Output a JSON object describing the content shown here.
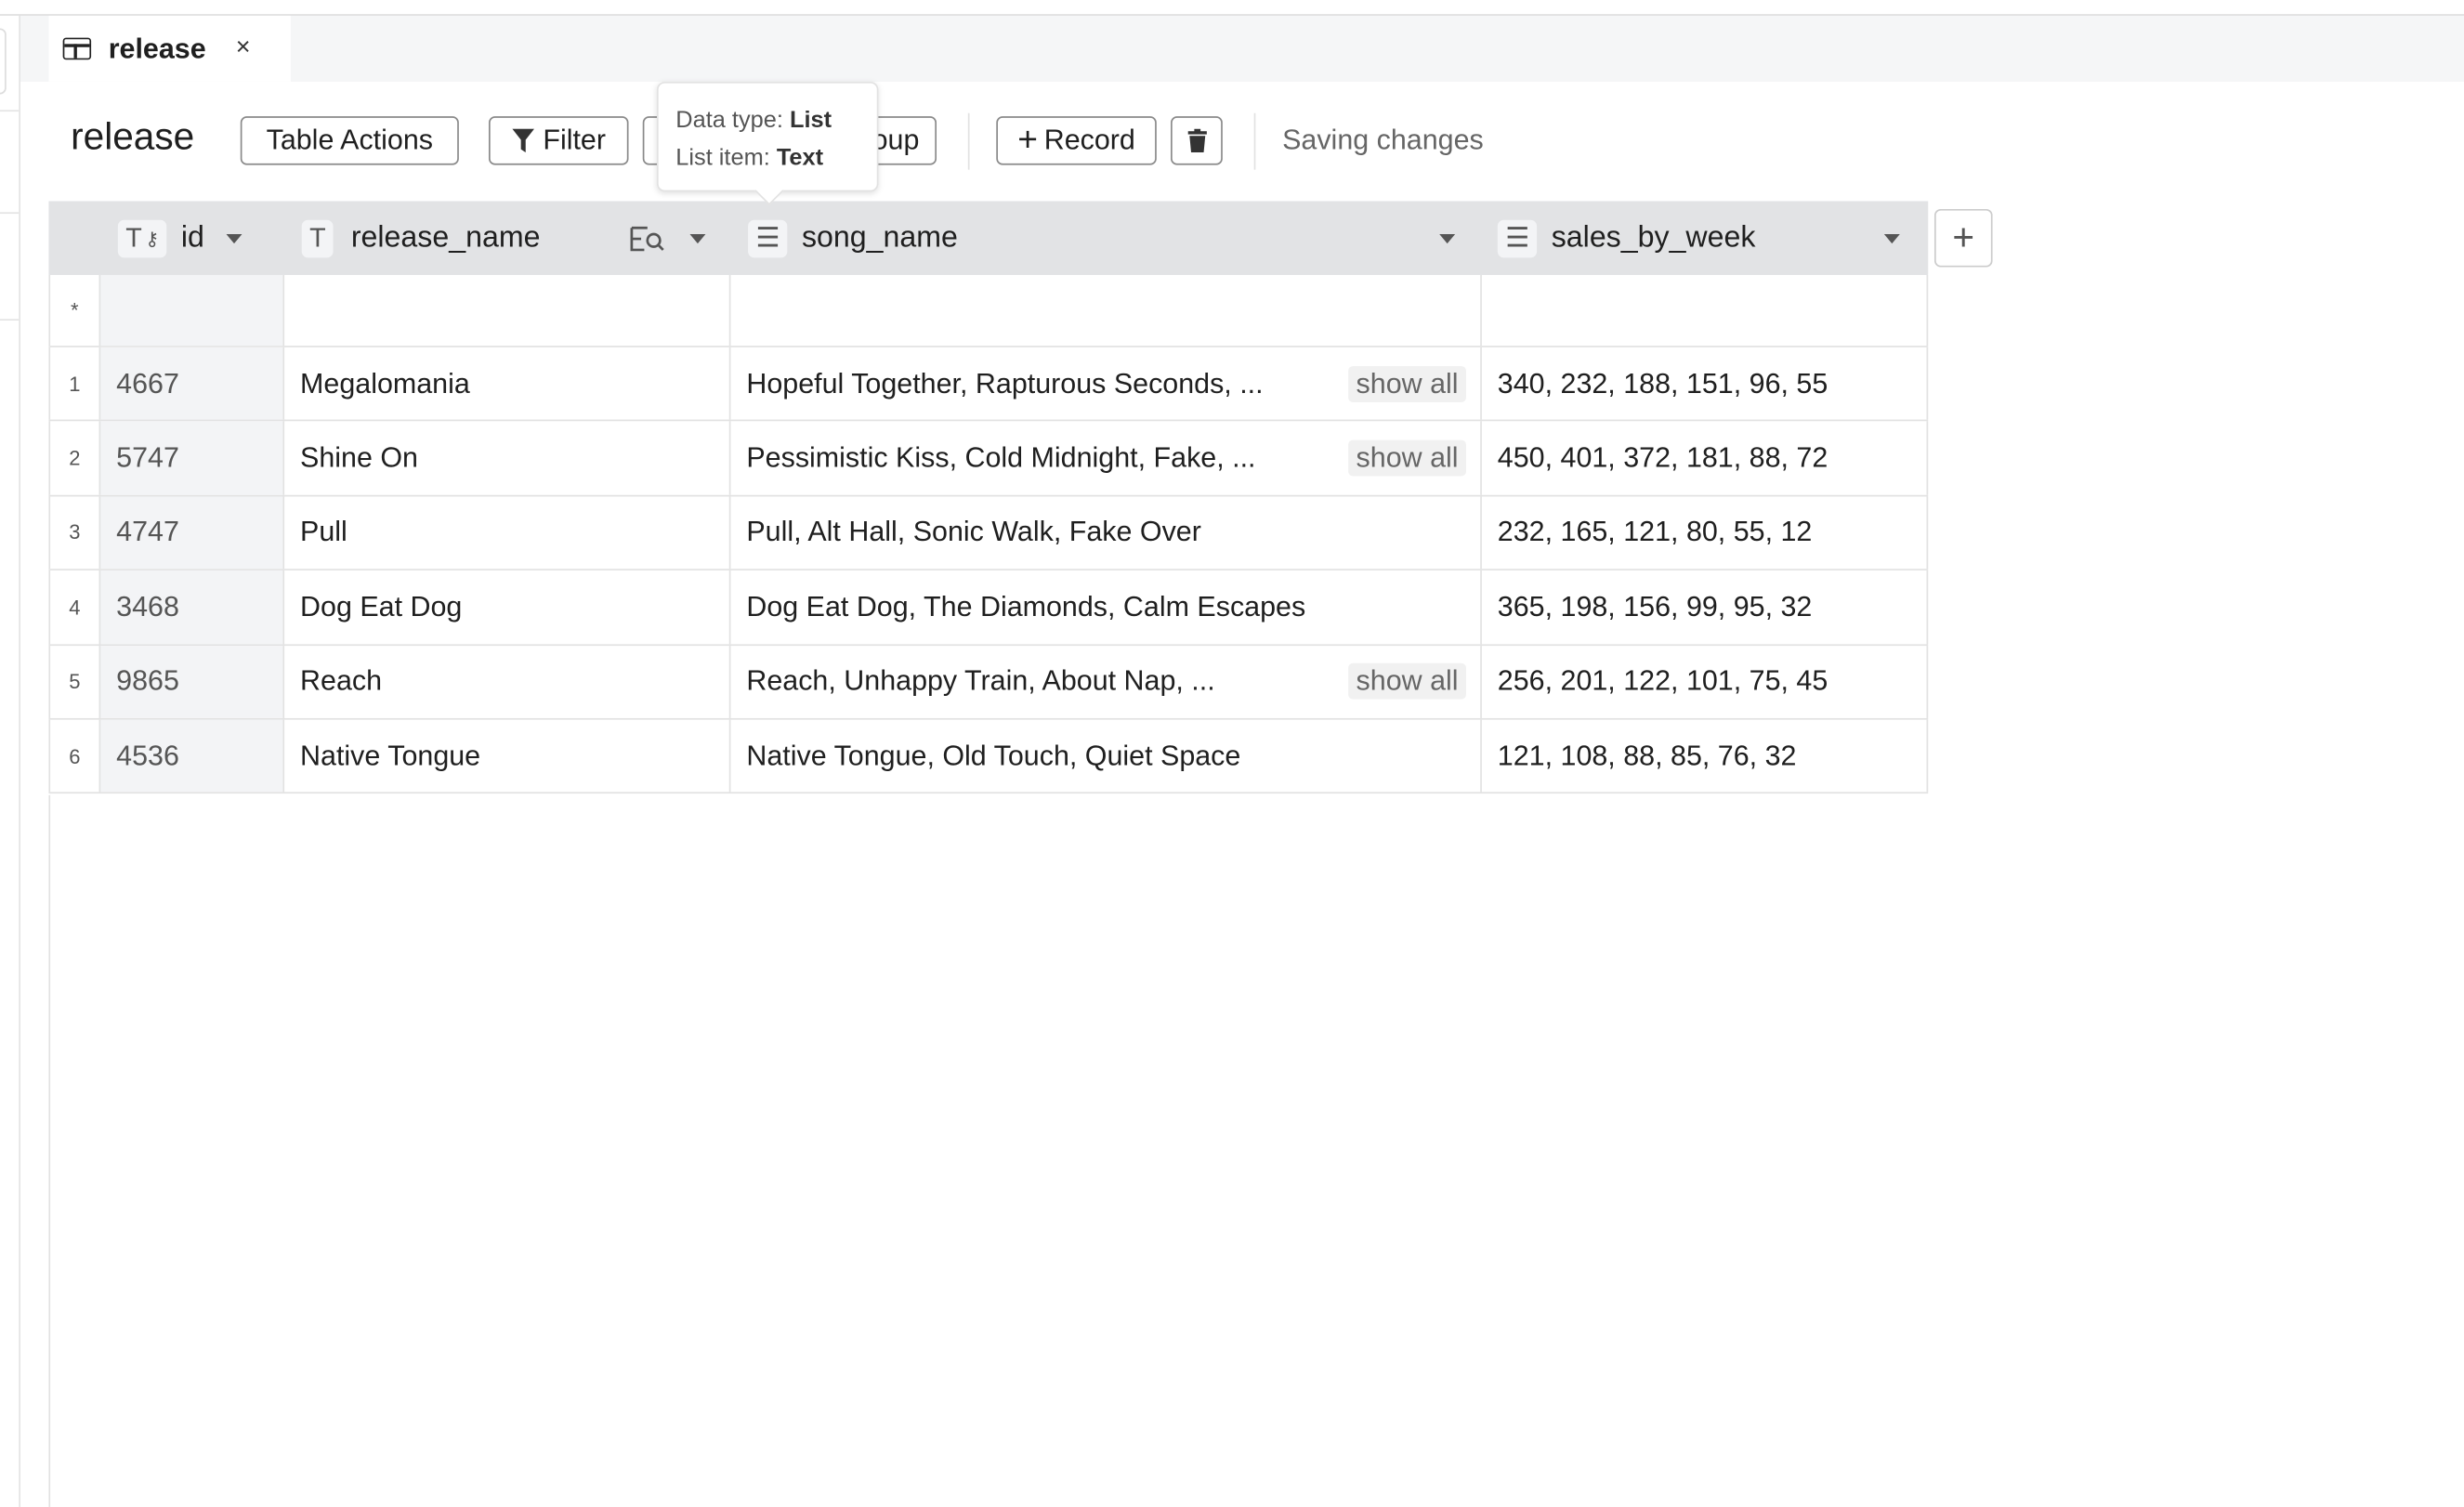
{
  "tab": {
    "label": "release",
    "icon": "table-icon",
    "close": "×"
  },
  "toolbar": {
    "title": "release",
    "table_actions": "Table Actions",
    "filter": "Filter",
    "group_partial": "oup",
    "record": "Record",
    "status": "Saving changes"
  },
  "tooltip": {
    "type_label": "Data type:",
    "type_value": "List",
    "item_label": "List item:",
    "item_value": "Text"
  },
  "columns": [
    {
      "name": "id",
      "type_icon": "T",
      "key_icon": "key-icon"
    },
    {
      "name": "release_name",
      "type_icon": "T"
    },
    {
      "name": "song_name",
      "type_icon": "list-icon"
    },
    {
      "name": "sales_by_week",
      "type_icon": "list-icon"
    }
  ],
  "new_row_marker": "*",
  "show_all_label": "show all",
  "rows": [
    {
      "num": "1",
      "id": "4667",
      "release_name": "Megalomania",
      "song_name": "Hopeful Together, Rapturous Seconds, ...",
      "show_all": true,
      "sales_by_week": "340, 232, 188, 151, 96, 55"
    },
    {
      "num": "2",
      "id": "5747",
      "release_name": "Shine On",
      "song_name": "Pessimistic Kiss, Cold Midnight, Fake, ...",
      "show_all": true,
      "sales_by_week": "450, 401, 372, 181, 88, 72"
    },
    {
      "num": "3",
      "id": "4747",
      "release_name": "Pull",
      "song_name": "Pull, Alt Hall, Sonic Walk, Fake Over",
      "show_all": false,
      "sales_by_week": "232, 165, 121, 80, 55, 12"
    },
    {
      "num": "4",
      "id": "3468",
      "release_name": "Dog Eat Dog",
      "song_name": "Dog Eat Dog, The Diamonds, Calm Escapes",
      "show_all": false,
      "sales_by_week": "365, 198, 156, 99, 95, 32"
    },
    {
      "num": "5",
      "id": "9865",
      "release_name": "Reach",
      "song_name": "Reach, Unhappy Train, About Nap, ...",
      "show_all": true,
      "sales_by_week": "256, 201, 122, 101, 75, 45"
    },
    {
      "num": "6",
      "id": "4536",
      "release_name": "Native Tongue",
      "song_name": "Native Tongue, Old Touch, Quiet Space",
      "show_all": false,
      "sales_by_week": "121, 108, 88, 85, 76, 32"
    }
  ]
}
